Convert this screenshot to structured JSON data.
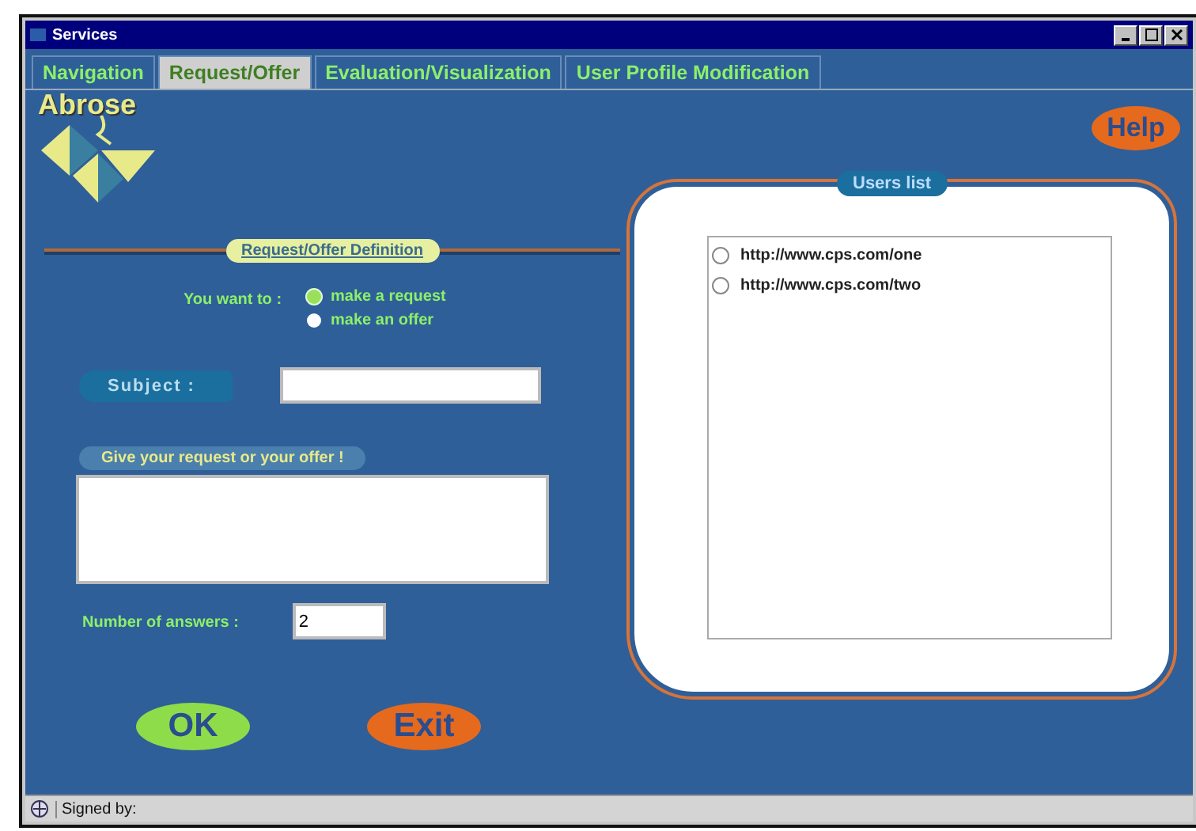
{
  "window": {
    "title": "Services"
  },
  "tabs": [
    {
      "label": "Navigation",
      "selected": false
    },
    {
      "label": "Request/Offer",
      "selected": true
    },
    {
      "label": "Evaluation/Visualization",
      "selected": false
    },
    {
      "label": "User Profile Modification",
      "selected": false
    }
  ],
  "logo": {
    "text": "Abrose"
  },
  "help_button": "Help",
  "definition": {
    "heading": "Request/Offer Definition",
    "prompt": "You want to :",
    "options": [
      {
        "label": "make a request",
        "selected": true
      },
      {
        "label": "make an offer",
        "selected": false
      }
    ],
    "subject_label": "Subject :",
    "request_label": "Give your request or your offer !",
    "answers_label": "Number of answers :",
    "answers_value": "2"
  },
  "users_list": {
    "heading": "Users list",
    "items": [
      {
        "label": "http://www.cps.com/one",
        "selected": false
      },
      {
        "label": "http://www.cps.com/two",
        "selected": false
      }
    ]
  },
  "buttons": {
    "ok": "OK",
    "exit": "Exit"
  },
  "status_bar": "Signed by:"
}
